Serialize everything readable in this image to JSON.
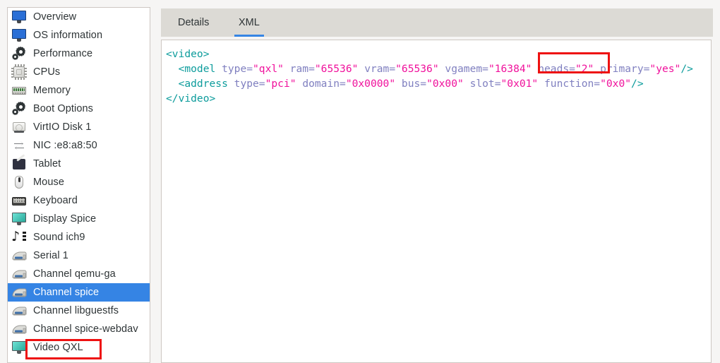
{
  "window": {
    "app": "virt-manager-vm-hardware-details"
  },
  "sidebar": {
    "name": "hardware-list",
    "selected_index": 15,
    "items": [
      {
        "label": "Overview",
        "icon": "monitor-blue-icon"
      },
      {
        "label": "OS information",
        "icon": "monitor-blue-icon"
      },
      {
        "label": "Performance",
        "icon": "gear-icon"
      },
      {
        "label": "CPUs",
        "icon": "cpu-chip-icon"
      },
      {
        "label": "Memory",
        "icon": "memory-stick-icon"
      },
      {
        "label": "Boot Options",
        "icon": "gear-icon"
      },
      {
        "label": "VirtIO Disk 1",
        "icon": "hard-disk-icon"
      },
      {
        "label": "NIC :e8:a8:50",
        "icon": "network-arrows-icon"
      },
      {
        "label": "Tablet",
        "icon": "tablet-icon"
      },
      {
        "label": "Mouse",
        "icon": "mouse-icon"
      },
      {
        "label": "Keyboard",
        "icon": "keyboard-icon"
      },
      {
        "label": "Display Spice",
        "icon": "display-teal-icon"
      },
      {
        "label": "Sound ich9",
        "icon": "sound-note-icon"
      },
      {
        "label": "Serial 1",
        "icon": "serial-device-icon"
      },
      {
        "label": "Channel qemu-ga",
        "icon": "serial-device-icon"
      },
      {
        "label": "Channel spice",
        "icon": "serial-device-icon"
      },
      {
        "label": "Channel libguestfs",
        "icon": "serial-device-icon"
      },
      {
        "label": "Channel spice-webdav",
        "icon": "serial-device-icon"
      },
      {
        "label": "Video QXL",
        "icon": "display-teal-icon"
      }
    ]
  },
  "tabs": {
    "details_label": "Details",
    "xml_label": "XML",
    "active": "XML"
  },
  "xml": {
    "lines": [
      {
        "indent": 0,
        "parts": [
          {
            "t": "tag",
            "s": "<video>"
          }
        ]
      },
      {
        "indent": 1,
        "parts": [
          {
            "t": "tag",
            "s": "<model"
          },
          {
            "t": "attr",
            "s": " type="
          },
          {
            "t": "val",
            "s": "\"qxl\""
          },
          {
            "t": "attr",
            "s": " ram="
          },
          {
            "t": "val",
            "s": "\"65536\""
          },
          {
            "t": "attr",
            "s": " vram="
          },
          {
            "t": "val",
            "s": "\"65536\""
          },
          {
            "t": "attr",
            "s": " vgamem="
          },
          {
            "t": "val",
            "s": "\"16384\""
          },
          {
            "t": "attr",
            "s": " heads="
          },
          {
            "t": "val",
            "s": "\"2\""
          },
          {
            "t": "attr",
            "s": " primary="
          },
          {
            "t": "val",
            "s": "\"yes\""
          },
          {
            "t": "tag",
            "s": "/>"
          }
        ]
      },
      {
        "indent": 1,
        "parts": [
          {
            "t": "tag",
            "s": "<address"
          },
          {
            "t": "attr",
            "s": " type="
          },
          {
            "t": "val",
            "s": "\"pci\""
          },
          {
            "t": "attr",
            "s": " domain="
          },
          {
            "t": "val",
            "s": "\"0x0000\""
          },
          {
            "t": "attr",
            "s": " bus="
          },
          {
            "t": "val",
            "s": "\"0x00\""
          },
          {
            "t": "attr",
            "s": " slot="
          },
          {
            "t": "val",
            "s": "\"0x01\""
          },
          {
            "t": "attr",
            "s": " function="
          },
          {
            "t": "val",
            "s": "\"0x0\""
          },
          {
            "t": "tag",
            "s": "/>"
          }
        ]
      },
      {
        "indent": 0,
        "parts": [
          {
            "t": "tag",
            "s": "</video>"
          }
        ]
      }
    ],
    "plain_text": "<video>\n  <model type=\"qxl\" ram=\"65536\" vram=\"65536\" vgamem=\"16384\" heads=\"2\" primary=\"yes\"/>\n  <address type=\"pci\" domain=\"0x0000\" bus=\"0x00\" slot=\"0x01\" function=\"0x0\"/>\n</video>"
  },
  "annotations": [
    {
      "name": "heads-attribute-highlight",
      "target": "heads=\"2\""
    },
    {
      "name": "video-qxl-item-highlight",
      "target": "Video QXL"
    }
  ],
  "colors": {
    "selection_blue": "#3584e4",
    "annotation_red": "#ee1111",
    "tabbar_gray": "#dcdad5",
    "xml_tag": "#0d9c9c",
    "xml_attr": "#8080c0",
    "xml_value": "#f0119c"
  }
}
